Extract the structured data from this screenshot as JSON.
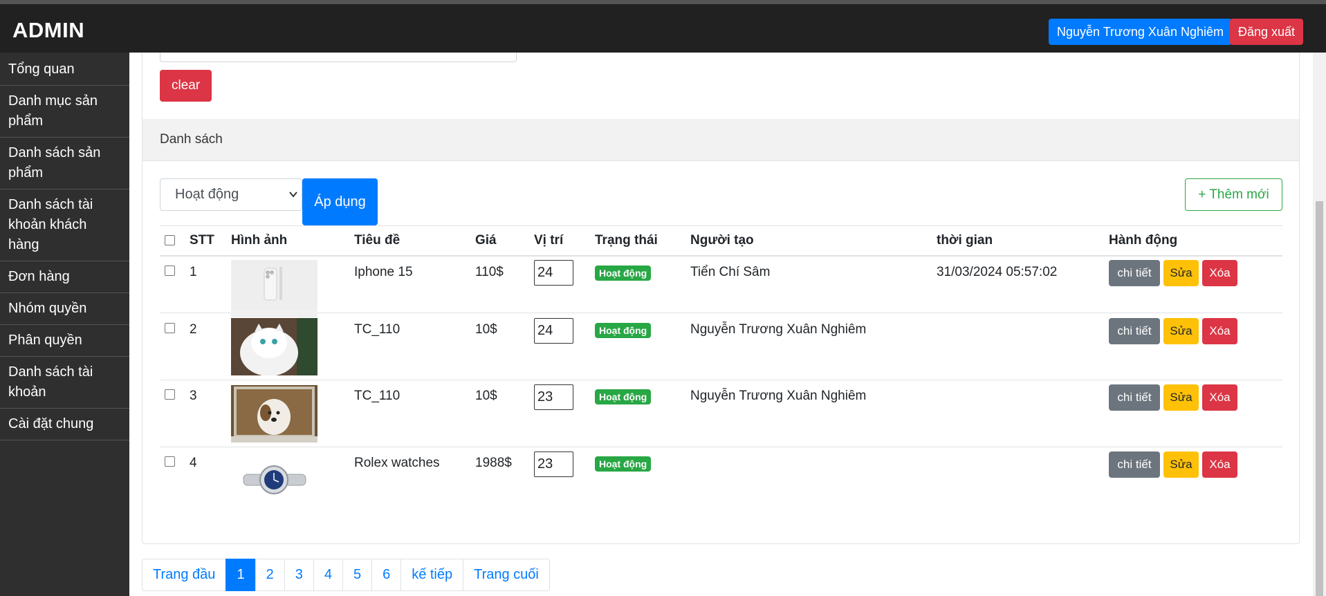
{
  "header": {
    "brand": "ADMIN",
    "user_name": "Nguyễn Trương Xuân Nghiêm",
    "logout_label": "Đăng xuất"
  },
  "sidebar": {
    "items": [
      {
        "label": "Tổng quan"
      },
      {
        "label": "Danh mục sản phẩm"
      },
      {
        "label": "Danh sách sản phẩm"
      },
      {
        "label": "Danh sách tài khoản khách hàng"
      },
      {
        "label": "Đơn hàng"
      },
      {
        "label": "Nhóm quyền"
      },
      {
        "label": "Phân quyền"
      },
      {
        "label": "Danh sách tài khoản"
      },
      {
        "label": "Cài đặt chung"
      }
    ]
  },
  "filters": {
    "clear_label": "clear",
    "section_title": "Danh sách",
    "status_selected": "Hoạt động",
    "apply_label": "Áp dụng",
    "add_label": "+ Thêm mới"
  },
  "table": {
    "headers": [
      "STT",
      "Hình ảnh",
      "Tiêu đề",
      "Giá",
      "Vị trí",
      "Trạng thái",
      "Người tạo",
      "thời gian",
      "Hành động"
    ],
    "rows": [
      {
        "stt": "1",
        "image": "iphone-image",
        "title": "Iphone 15",
        "price": "110$",
        "position": "24",
        "status": "Hoạt động",
        "creator": "Tiển Chí Sâm",
        "time": "31/03/2024 05:57:02"
      },
      {
        "stt": "2",
        "image": "white-cat-image",
        "title": "TC_110",
        "price": "10$",
        "position": "24",
        "status": "Hoạt động",
        "creator": "Nguyễn Trương Xuân Nghiêm",
        "time": ""
      },
      {
        "stt": "3",
        "image": "dog-window-image",
        "title": "TC_110",
        "price": "10$",
        "position": "23",
        "status": "Hoạt động",
        "creator": "Nguyễn Trương Xuân Nghiêm",
        "time": ""
      },
      {
        "stt": "4",
        "image": "rolex-watch-image",
        "title": "Rolex watches",
        "price": "1988$",
        "position": "23",
        "status": "Hoạt động",
        "creator": "",
        "time": ""
      }
    ],
    "actions": {
      "detail": "chi tiết",
      "edit": "Sửa",
      "delete": "Xóa"
    }
  },
  "pagination": {
    "first": "Trang đầu",
    "pages": [
      "1",
      "2",
      "3",
      "4",
      "5",
      "6"
    ],
    "current": "1",
    "next": "kế tiếp",
    "last": "Trang cuối"
  }
}
